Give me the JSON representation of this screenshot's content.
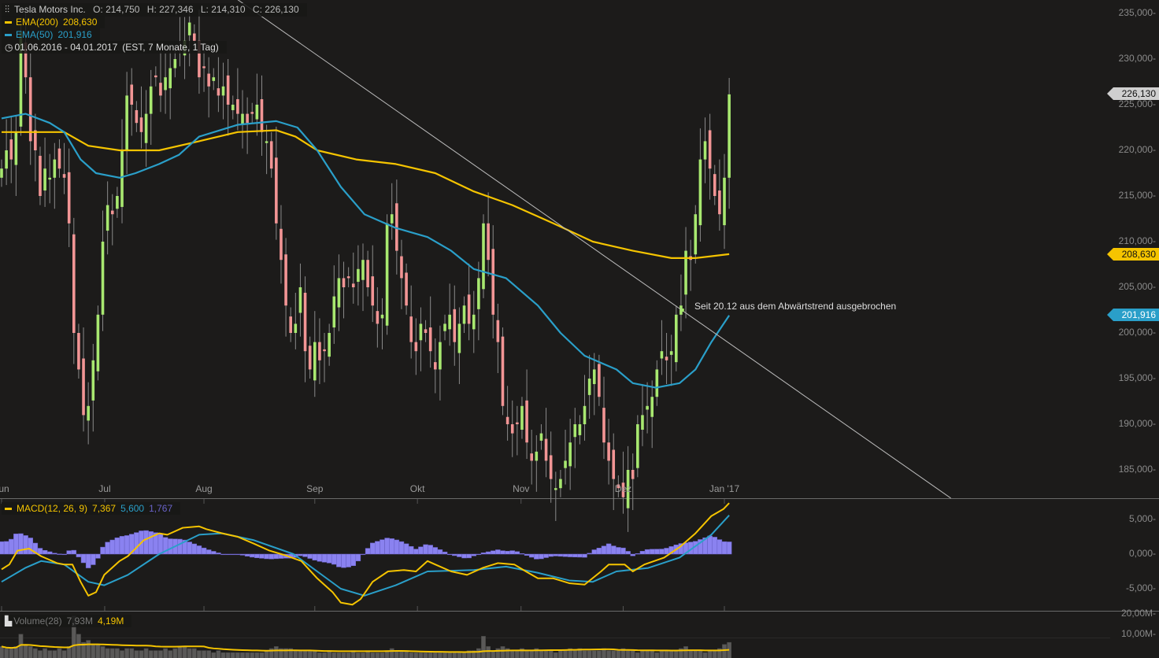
{
  "header": {
    "title": "Tesla Motors Inc.",
    "open": "O: 214,750",
    "high": "H: 227,346",
    "low": "L: 214,310",
    "close": "C: 226,130",
    "range": "01.06.2016 - 04.01.2017",
    "range_info": "(EST, 7 Monate, 1 Tag)"
  },
  "indicators": {
    "ema200": {
      "label": "EMA(200)",
      "value": "208,630",
      "color": "#f5c400"
    },
    "ema50": {
      "label": "EMA(50)",
      "value": "201,916",
      "color": "#2a9fc9"
    },
    "macd": {
      "label": "MACD(12, 26, 9)",
      "macd": "7,367",
      "signal": "5,600",
      "hist": "1,767"
    },
    "volume": {
      "label": "Volume(28)",
      "value": "7,93M",
      "avg": "4,19M"
    }
  },
  "price_tags": {
    "last": "226,130",
    "ema200": "208,630",
    "ema50": "201,916"
  },
  "annotation": "Seit 20.12 aus dem Abwärtstrend ausgebrochen",
  "colors": {
    "up": "#a8e870",
    "down": "#f29595",
    "ema200": "#f5c400",
    "ema50": "#2a9fc9",
    "hist": "#8a82f0",
    "bg": "#1c1b1a"
  },
  "chart_data": {
    "type": "candlestick",
    "title": "Tesla Motors Inc.",
    "price_axis": {
      "ticks": [
        "235,000",
        "230,000",
        "225,000",
        "220,000",
        "215,000",
        "210,000",
        "205,000",
        "200,000",
        "195,000",
        "190,000",
        "185,000"
      ],
      "tick_values": [
        235,
        230,
        225,
        220,
        215,
        210,
        205,
        200,
        195,
        190,
        185
      ],
      "range": [
        182,
        236.5
      ]
    },
    "months": [
      {
        "label": "Jun",
        "index": 0
      },
      {
        "label": "Jul",
        "index": 21.4
      },
      {
        "label": "Aug",
        "index": 42
      },
      {
        "label": "Sep",
        "index": 65
      },
      {
        "label": "Okt",
        "index": 86.3
      },
      {
        "label": "Nov",
        "index": 107.8
      },
      {
        "label": "Dez",
        "index": 129
      },
      {
        "label": "Jan '17",
        "index": 150
      }
    ],
    "close": [
      218,
      220,
      219,
      222,
      233,
      228,
      221,
      220,
      215,
      218,
      217,
      219,
      218,
      217,
      212,
      200,
      196,
      191,
      192,
      197,
      202,
      210,
      214,
      213,
      215,
      220,
      226,
      225,
      223,
      222,
      224,
      227,
      228,
      226,
      228,
      229,
      230,
      231,
      232,
      234,
      232,
      228,
      229,
      227,
      228,
      226,
      227,
      225,
      225,
      224,
      224,
      223,
      224,
      225,
      222,
      221,
      218,
      212,
      208,
      203,
      200,
      201,
      205,
      198,
      196,
      199,
      197,
      198,
      200,
      204,
      206,
      205,
      206,
      205,
      207,
      208,
      205,
      203,
      201,
      202,
      212,
      213,
      209,
      206,
      203,
      199,
      198,
      201,
      200,
      198,
      196,
      199,
      201,
      202,
      199,
      201,
      203,
      201,
      202,
      206,
      212,
      208,
      202,
      199,
      192,
      190,
      189,
      190,
      192,
      188,
      186,
      187,
      189,
      186,
      184,
      183,
      184,
      186,
      188,
      190,
      190,
      192,
      195,
      196,
      193,
      188,
      186,
      184,
      183,
      182,
      185,
      184,
      190,
      191,
      192,
      193,
      196,
      198,
      197,
      198,
      202,
      203,
      209,
      208,
      213,
      219,
      221,
      218,
      215,
      213,
      217,
      226.13
    ],
    "ema200": [
      [
        0,
        222
      ],
      [
        6.5,
        222
      ],
      [
        13,
        222
      ],
      [
        18,
        220.5
      ],
      [
        24.5,
        220
      ],
      [
        32.7,
        220
      ],
      [
        41,
        221
      ],
      [
        49,
        222
      ],
      [
        57,
        222.2
      ],
      [
        61,
        221.5
      ],
      [
        65.5,
        220
      ],
      [
        73.6,
        219
      ],
      [
        81.8,
        218.5
      ],
      [
        90,
        217.5
      ],
      [
        98,
        215.5
      ],
      [
        106,
        214
      ],
      [
        114.5,
        212
      ],
      [
        122.7,
        210
      ],
      [
        131,
        209
      ],
      [
        139,
        208.2
      ],
      [
        144,
        208.2
      ],
      [
        151,
        208.63
      ]
    ],
    "ema50": [
      [
        0,
        223.5
      ],
      [
        5,
        224
      ],
      [
        10,
        223
      ],
      [
        13,
        222
      ],
      [
        16.4,
        219
      ],
      [
        19.6,
        217.5
      ],
      [
        24.5,
        217
      ],
      [
        27.8,
        217.5
      ],
      [
        32.7,
        218.5
      ],
      [
        36.8,
        219.5
      ],
      [
        41,
        221.5
      ],
      [
        49,
        222.8
      ],
      [
        57,
        223.2
      ],
      [
        61.4,
        222.5
      ],
      [
        65.5,
        220
      ],
      [
        70.4,
        216
      ],
      [
        75.3,
        213
      ],
      [
        81.8,
        211.5
      ],
      [
        88.4,
        210.5
      ],
      [
        93.3,
        209
      ],
      [
        98,
        207
      ],
      [
        104.7,
        206
      ],
      [
        111.3,
        203
      ],
      [
        116,
        200
      ],
      [
        121,
        197.5
      ],
      [
        127.6,
        196
      ],
      [
        131,
        194.5
      ],
      [
        135.8,
        194
      ],
      [
        140.7,
        194.5
      ],
      [
        144,
        196
      ],
      [
        147.3,
        199
      ],
      [
        151,
        201.916
      ]
    ],
    "macd_axis": {
      "ticks": [
        "5,000-",
        "0,000-",
        "-5,000-"
      ],
      "tick_values": [
        5,
        0,
        -5
      ]
    },
    "macd": [
      [
        0,
        -2.2
      ],
      [
        1.6,
        -1.5
      ],
      [
        3.3,
        0.5
      ],
      [
        5.7,
        0.8
      ],
      [
        8.2,
        -0.3
      ],
      [
        11.5,
        -1.3
      ],
      [
        13,
        -1.5
      ],
      [
        14.7,
        -1.5
      ],
      [
        16.4,
        -4
      ],
      [
        18,
        -6
      ],
      [
        19.6,
        -5.5
      ],
      [
        21.3,
        -3
      ],
      [
        24.5,
        -1
      ],
      [
        26.2,
        -0.3
      ],
      [
        27.8,
        0.8
      ],
      [
        29.5,
        2
      ],
      [
        32.7,
        3
      ],
      [
        34.4,
        2.8
      ],
      [
        37.6,
        3.8
      ],
      [
        41,
        4
      ],
      [
        42.5,
        3.6
      ],
      [
        45.8,
        3
      ],
      [
        49,
        2.5
      ],
      [
        52.4,
        1.5
      ],
      [
        55.6,
        0.5
      ],
      [
        59,
        -0.2
      ],
      [
        62.2,
        -1
      ],
      [
        65.5,
        -3.5
      ],
      [
        68.7,
        -5.5
      ],
      [
        70.4,
        -7
      ],
      [
        72.8,
        -7.3
      ],
      [
        74.5,
        -6.5
      ],
      [
        77,
        -4
      ],
      [
        80.2,
        -2.5
      ],
      [
        83.5,
        -2.3
      ],
      [
        86,
        -2.5
      ],
      [
        88.4,
        -1
      ],
      [
        90,
        -1.5
      ],
      [
        93.3,
        -2.5
      ],
      [
        96.6,
        -3
      ],
      [
        99.8,
        -2
      ],
      [
        103,
        -1.3
      ],
      [
        106.4,
        -1.5
      ],
      [
        108.8,
        -2.5
      ],
      [
        111.3,
        -3.5
      ],
      [
        114.5,
        -3.5
      ],
      [
        117.8,
        -4.2
      ],
      [
        121,
        -4.4
      ],
      [
        124.4,
        -2.5
      ],
      [
        126,
        -1.5
      ],
      [
        129.3,
        -1.5
      ],
      [
        131,
        -2.5
      ],
      [
        133.4,
        -1.5
      ],
      [
        137.5,
        -0.5
      ],
      [
        140.7,
        1
      ],
      [
        144,
        3
      ],
      [
        147.3,
        5.5
      ],
      [
        149.8,
        6.5
      ],
      [
        151,
        7.367
      ]
    ],
    "signal": [
      [
        0,
        -4
      ],
      [
        4.9,
        -2
      ],
      [
        8.2,
        -1
      ],
      [
        13,
        -1.5
      ],
      [
        18,
        -4
      ],
      [
        21.3,
        -4.5
      ],
      [
        26.2,
        -3
      ],
      [
        32.7,
        0
      ],
      [
        41,
        2.8
      ],
      [
        45.8,
        3
      ],
      [
        52.4,
        2
      ],
      [
        60.6,
        0
      ],
      [
        65.5,
        -2.5
      ],
      [
        70.4,
        -5
      ],
      [
        75.3,
        -6
      ],
      [
        81.8,
        -4.5
      ],
      [
        88.4,
        -2.5
      ],
      [
        98,
        -2.3
      ],
      [
        104.7,
        -1.8
      ],
      [
        111.3,
        -2.7
      ],
      [
        117.8,
        -3.8
      ],
      [
        122.7,
        -4
      ],
      [
        127.6,
        -2.5
      ],
      [
        134.2,
        -2
      ],
      [
        140.7,
        -0.5
      ],
      [
        147.3,
        2.8
      ],
      [
        151,
        5.6
      ]
    ],
    "volume_axis": {
      "ticks": [
        "20,00M-",
        "10,00M-"
      ],
      "tick_values": [
        20,
        10
      ]
    },
    "volume_millions": [
      6,
      5,
      5,
      6,
      12,
      7,
      6,
      5,
      4,
      5,
      4,
      4,
      5,
      4,
      6,
      21,
      12,
      8,
      9,
      7,
      7,
      6,
      5,
      5,
      5,
      4,
      5,
      5,
      4,
      4,
      5,
      4,
      4,
      4,
      5,
      4,
      5,
      6,
      6,
      5,
      5,
      4,
      4,
      4,
      3,
      4,
      3,
      3,
      3,
      3,
      3,
      3,
      3,
      3,
      3,
      4,
      5,
      6,
      5,
      5,
      5,
      4,
      4,
      4,
      4,
      4,
      3,
      3,
      4,
      3,
      3,
      3,
      3,
      4,
      3,
      3,
      4,
      3,
      3,
      3,
      4,
      5,
      4,
      4,
      4,
      3,
      3,
      3,
      3,
      3,
      3,
      3,
      3,
      3,
      3,
      3,
      3,
      4,
      4,
      5,
      11,
      6,
      4,
      5,
      6,
      5,
      4,
      4,
      5,
      4,
      4,
      5,
      4,
      4,
      4,
      3,
      4,
      4,
      5,
      4,
      5,
      4,
      4,
      4,
      4,
      5,
      4,
      4,
      4,
      5,
      4,
      4,
      3,
      4,
      4,
      4,
      3,
      4,
      4,
      4,
      4,
      5,
      6,
      4,
      4,
      4,
      3,
      4,
      4,
      5,
      7,
      8
    ],
    "trendline": [
      [
        49,
        236.5
      ],
      [
        197,
        181.9
      ]
    ],
    "annotation_point": [
      141.3,
      202.5
    ]
  }
}
